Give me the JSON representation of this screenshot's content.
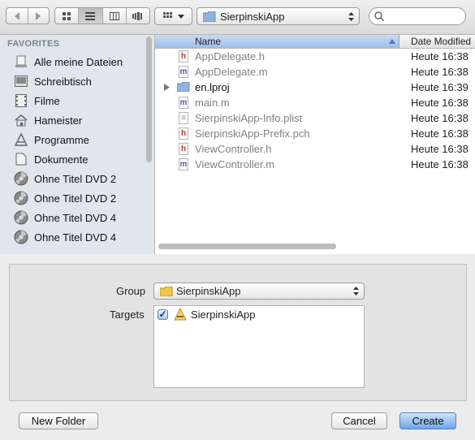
{
  "toolbar": {
    "back_icon": "chevron-left-icon",
    "forward_icon": "chevron-right-icon",
    "view_modes": [
      "icon-view-icon",
      "list-view-icon",
      "column-view-icon",
      "coverflow-view-icon"
    ],
    "arrange_icon": "grid-icon",
    "location": "SierpinskiApp",
    "search_placeholder": ""
  },
  "sidebar": {
    "header": "FAVORITES",
    "items": [
      {
        "label": "Alle meine Dateien",
        "icon": "all-files-icon"
      },
      {
        "label": "Schreibtisch",
        "icon": "desktop-icon"
      },
      {
        "label": "Filme",
        "icon": "movies-icon"
      },
      {
        "label": "Hameister",
        "icon": "home-icon"
      },
      {
        "label": "Programme",
        "icon": "applications-icon"
      },
      {
        "label": "Dokumente",
        "icon": "documents-icon"
      },
      {
        "label": "Ohne Titel DVD 2",
        "icon": "dvd-icon"
      },
      {
        "label": "Ohne Titel DVD 2",
        "icon": "dvd-icon"
      },
      {
        "label": "Ohne Titel DVD 4",
        "icon": "dvd-icon"
      },
      {
        "label": "Ohne Titel DVD 4",
        "icon": "dvd-icon"
      }
    ]
  },
  "files": {
    "columns": {
      "name": "Name",
      "date": "Date Modified"
    },
    "rows": [
      {
        "name": "AppDelegate.h",
        "date": "Heute 16:38",
        "type": "h"
      },
      {
        "name": "AppDelegate.m",
        "date": "Heute 16:38",
        "type": "m"
      },
      {
        "name": "en.lproj",
        "date": "Heute 16:39",
        "type": "folder"
      },
      {
        "name": "main.m",
        "date": "Heute 16:38",
        "type": "m"
      },
      {
        "name": "SierpinskiApp-Info.plist",
        "date": "Heute 16:38",
        "type": "plist"
      },
      {
        "name": "SierpinskiApp-Prefix.pch",
        "date": "Heute 16:38",
        "type": "h"
      },
      {
        "name": "ViewController.h",
        "date": "Heute 16:38",
        "type": "h"
      },
      {
        "name": "ViewController.m",
        "date": "Heute 16:38",
        "type": "m"
      }
    ]
  },
  "options": {
    "group_label": "Group",
    "group_value": "SierpinskiApp",
    "targets_label": "Targets",
    "target_name": "SierpinskiApp",
    "target_checked": true
  },
  "buttons": {
    "new_folder": "New Folder",
    "cancel": "Cancel",
    "create": "Create"
  },
  "colors": {
    "accent": "#6fa6e8",
    "sidebar_bg": "#e1e6ed",
    "header_selected": "#9cbfe9"
  }
}
